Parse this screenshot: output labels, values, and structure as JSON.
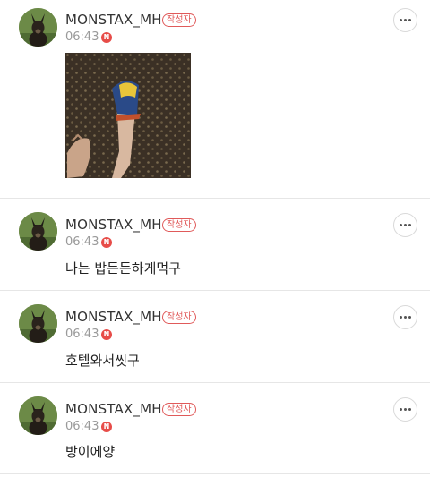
{
  "posts": [
    {
      "author": "MONSTAX_MH",
      "badge": "작성자",
      "time": "06:43",
      "new_marker": "N",
      "text": "",
      "has_photo": true
    },
    {
      "author": "MONSTAX_MH",
      "badge": "작성자",
      "time": "06:43",
      "new_marker": "N",
      "text": "나는 밥든든하게먹구",
      "has_photo": false
    },
    {
      "author": "MONSTAX_MH",
      "badge": "작성자",
      "time": "06:43",
      "new_marker": "N",
      "text": "호텔와서씻구",
      "has_photo": false
    },
    {
      "author": "MONSTAX_MH",
      "badge": "작성자",
      "time": "06:43",
      "new_marker": "N",
      "text": "방이에양",
      "has_photo": false
    }
  ],
  "icons": {
    "more": "more-options-icon",
    "new": "new-badge-icon"
  },
  "colors": {
    "accent": "#e05a5a",
    "new_dot": "#e74c48",
    "divider": "#e6e6e6",
    "meta_text": "#9a9a9a"
  }
}
